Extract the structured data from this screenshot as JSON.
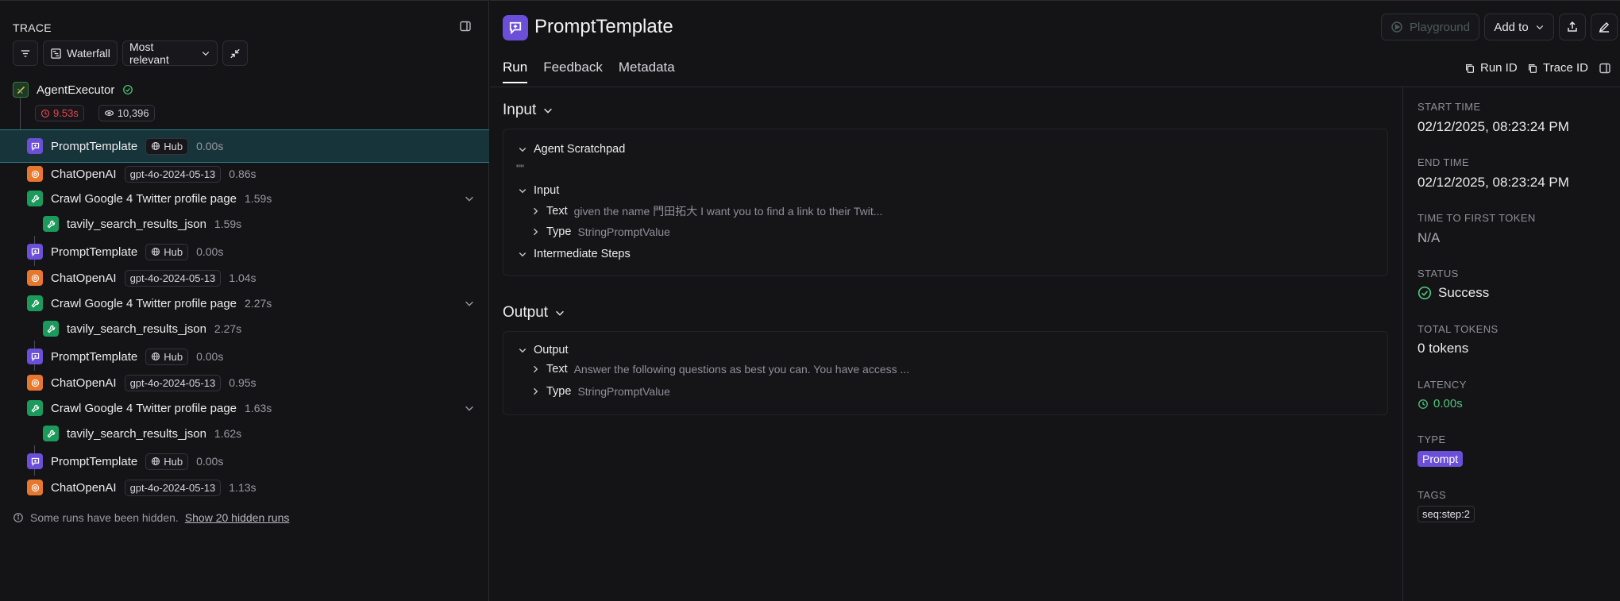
{
  "trace": {
    "title": "TRACE",
    "toolbar": {
      "waterfall_label": "Waterfall",
      "sort_label": "Most relevant"
    },
    "root": {
      "name": "AgentExecutor",
      "latency": "9.53s",
      "tokens": "10,396"
    },
    "rows": [
      {
        "type": "prompt",
        "name": "PromptTemplate",
        "chip": "Hub",
        "duration": "0.00s"
      },
      {
        "type": "llm",
        "name": "ChatOpenAI",
        "chip": "gpt-4o-2024-05-13",
        "duration": "0.86s"
      },
      {
        "type": "tool",
        "name": "Crawl Google 4 Twitter profile page",
        "duration": "1.59s"
      },
      {
        "type": "tool",
        "name": "tavily_search_results_json",
        "duration": "1.59s"
      },
      {
        "type": "prompt",
        "name": "PromptTemplate",
        "chip": "Hub",
        "duration": "0.00s"
      },
      {
        "type": "llm",
        "name": "ChatOpenAI",
        "chip": "gpt-4o-2024-05-13",
        "duration": "1.04s"
      },
      {
        "type": "tool",
        "name": "Crawl Google 4 Twitter profile page",
        "duration": "2.27s"
      },
      {
        "type": "tool",
        "name": "tavily_search_results_json",
        "duration": "2.27s"
      },
      {
        "type": "prompt",
        "name": "PromptTemplate",
        "chip": "Hub",
        "duration": "0.00s"
      },
      {
        "type": "llm",
        "name": "ChatOpenAI",
        "chip": "gpt-4o-2024-05-13",
        "duration": "0.95s"
      },
      {
        "type": "tool",
        "name": "Crawl Google 4 Twitter profile page",
        "duration": "1.63s"
      },
      {
        "type": "tool",
        "name": "tavily_search_results_json",
        "duration": "1.62s"
      },
      {
        "type": "prompt",
        "name": "PromptTemplate",
        "chip": "Hub",
        "duration": "0.00s"
      },
      {
        "type": "llm",
        "name": "ChatOpenAI",
        "chip": "gpt-4o-2024-05-13",
        "duration": "1.13s"
      }
    ],
    "hidden_note": "Some runs have been hidden.",
    "hidden_link": "Show 20 hidden runs"
  },
  "main": {
    "title": "PromptTemplate",
    "buttons": {
      "playground": "Playground",
      "add_to": "Add to"
    },
    "tabs": [
      "Run",
      "Feedback",
      "Metadata"
    ],
    "run_id_label": "Run ID",
    "trace_id_label": "Trace ID",
    "input": {
      "title": "Input",
      "scratchpad_label": "Agent Scratchpad",
      "scratchpad_value": "\"\"",
      "input_label": "Input",
      "text_key": "Text",
      "text_value": "given the name 門田拓大 I want you to find a link to their Twit...",
      "type_key": "Type",
      "type_value": "StringPromptValue",
      "steps_label": "Intermediate Steps"
    },
    "output": {
      "title": "Output",
      "output_label": "Output",
      "text_key": "Text",
      "text_value": "Answer the following questions as best you can. You have access ...",
      "type_key": "Type",
      "type_value": "StringPromptValue"
    }
  },
  "meta": {
    "start_time_label": "START TIME",
    "start_time": "02/12/2025, 08:23:24 PM",
    "end_time_label": "END TIME",
    "end_time": "02/12/2025, 08:23:24 PM",
    "ttft_label": "TIME TO FIRST TOKEN",
    "ttft": "N/A",
    "status_label": "STATUS",
    "status": "Success",
    "total_tokens_label": "TOTAL TOKENS",
    "total_tokens": "0 tokens",
    "latency_label": "LATENCY",
    "latency": "0.00s",
    "type_label": "TYPE",
    "type": "Prompt",
    "tags_label": "TAGS",
    "tag": "seq:step:2"
  },
  "colors": {
    "prompt": "#6b4fd8",
    "llm": "#e8772e",
    "tool": "#1c9a5c",
    "success": "#4fc27a",
    "error": "#e5484d",
    "selected_bg": "#17343a"
  },
  "icons": {
    "prompt": "prompt-bubble-icon",
    "llm": "openai-icon",
    "tool": "wrench-icon",
    "chain": "chain-icon"
  }
}
